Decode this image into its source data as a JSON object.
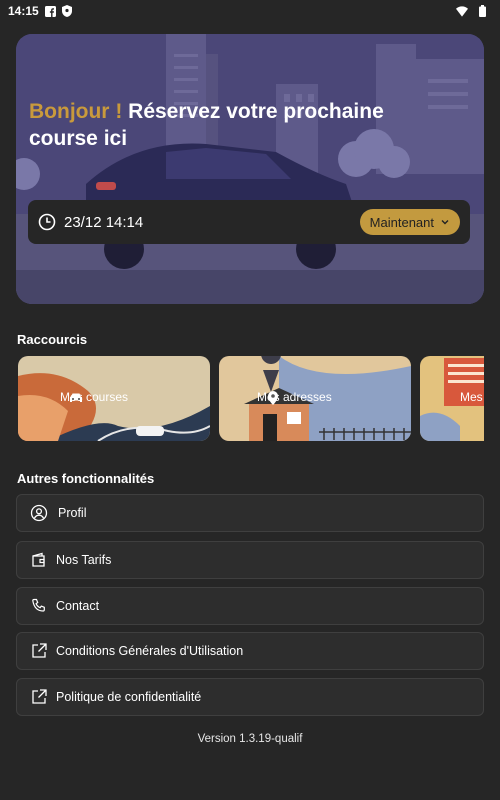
{
  "status_bar": {
    "time": "14:15",
    "icons": [
      "facebook-icon",
      "shield-icon",
      "wifi-icon",
      "battery-icon"
    ]
  },
  "hero": {
    "greeting": "Bonjour !",
    "title": "Réservez votre prochaine course ici",
    "datetime": "23/12 14:14",
    "now_button": "Maintenant"
  },
  "shortcuts": {
    "title": "Raccourcis",
    "items": [
      {
        "label": "Mes courses",
        "icon": "car-icon"
      },
      {
        "label": "Mes adresses",
        "icon": "location-pin-icon"
      },
      {
        "label": "Mes",
        "icon": "document-icon"
      }
    ]
  },
  "features": {
    "title": "Autres fonctionnalités",
    "items": [
      {
        "label": "Profil",
        "icon": "user-icon"
      },
      {
        "label": "Nos Tarifs",
        "icon": "wallet-icon"
      },
      {
        "label": "Contact",
        "icon": "phone-icon"
      },
      {
        "label": "Conditions Générales d'Utilisation",
        "icon": "external-link-icon"
      },
      {
        "label": "Politique de confidentialité",
        "icon": "external-link-icon"
      }
    ]
  },
  "version": "Version 1.3.19-qualif",
  "colors": {
    "background": "#262626",
    "accent": "#c39a3f",
    "card": "#2d2d2d"
  }
}
